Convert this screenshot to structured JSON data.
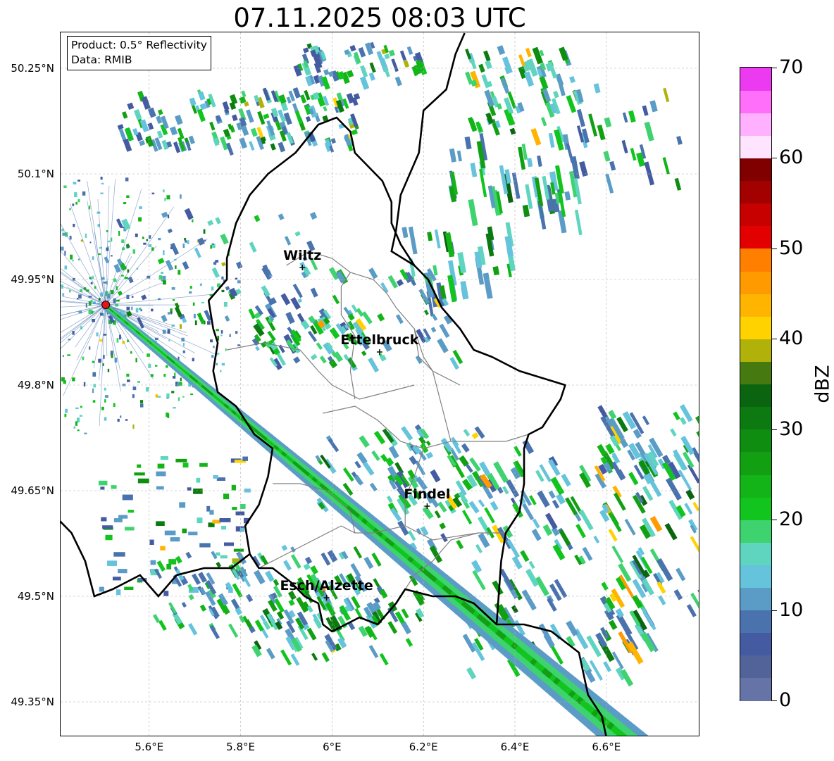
{
  "title": "07.11.2025 08:03 UTC",
  "info": {
    "product": "Product: 0.5° Reflectivity",
    "data": "Data: RMIB"
  },
  "map": {
    "lon_range": [
      5.4,
      6.8
    ],
    "lat_range": [
      49.3,
      50.3
    ],
    "lat_ticks": [
      {
        "value": 50.25,
        "label": "50.25°N"
      },
      {
        "value": 50.1,
        "label": "50.1°N"
      },
      {
        "value": 49.95,
        "label": "49.95°N"
      },
      {
        "value": 49.8,
        "label": "49.8°N"
      },
      {
        "value": 49.65,
        "label": "49.65°N"
      },
      {
        "value": 49.5,
        "label": "49.5°N"
      },
      {
        "value": 49.35,
        "label": "49.35°N"
      }
    ],
    "lon_ticks": [
      {
        "value": 5.6,
        "label": "5.6°E"
      },
      {
        "value": 5.8,
        "label": "5.8°E"
      },
      {
        "value": 6.0,
        "label": "6°E"
      },
      {
        "value": 6.2,
        "label": "6.2°E"
      },
      {
        "value": 6.4,
        "label": "6.4°E"
      },
      {
        "value": 6.6,
        "label": "6.6°E"
      }
    ],
    "grid": true,
    "radar_site": {
      "lon": 5.505,
      "lat": 49.914,
      "color": "#e8141b"
    },
    "cities": [
      {
        "name": "Wiltz",
        "lon": 5.935,
        "lat": 49.967
      },
      {
        "name": "Ettelbruck",
        "lon": 6.104,
        "lat": 49.847
      },
      {
        "name": "Findel",
        "lon": 6.208,
        "lat": 49.628
      },
      {
        "name": "Esch/Alzette",
        "lon": 5.988,
        "lat": 49.498
      }
    ],
    "luxembourg_border": [
      [
        5.92,
        50.13
      ],
      [
        5.97,
        50.17
      ],
      [
        6.01,
        50.18
      ],
      [
        6.04,
        50.16
      ],
      [
        6.05,
        50.13
      ],
      [
        6.08,
        50.11
      ],
      [
        6.11,
        50.09
      ],
      [
        6.13,
        50.06
      ],
      [
        6.13,
        50.03
      ],
      [
        6.15,
        50.0
      ],
      [
        6.18,
        49.97
      ],
      [
        6.21,
        49.95
      ],
      [
        6.24,
        49.91
      ],
      [
        6.28,
        49.88
      ],
      [
        6.31,
        49.85
      ],
      [
        6.35,
        49.84
      ],
      [
        6.41,
        49.82
      ],
      [
        6.46,
        49.81
      ],
      [
        6.51,
        49.8
      ],
      [
        6.5,
        49.78
      ],
      [
        6.48,
        49.76
      ],
      [
        6.46,
        49.74
      ],
      [
        6.43,
        49.73
      ],
      [
        6.42,
        49.71
      ],
      [
        6.42,
        49.66
      ],
      [
        6.41,
        49.62
      ],
      [
        6.38,
        49.59
      ],
      [
        6.37,
        49.55
      ],
      [
        6.36,
        49.46
      ],
      [
        6.31,
        49.49
      ],
      [
        6.27,
        49.5
      ],
      [
        6.22,
        49.5
      ],
      [
        6.16,
        49.51
      ],
      [
        6.14,
        49.49
      ],
      [
        6.1,
        49.46
      ],
      [
        6.06,
        49.47
      ],
      [
        6.0,
        49.45
      ],
      [
        5.98,
        49.46
      ],
      [
        5.97,
        49.49
      ],
      [
        5.94,
        49.5
      ],
      [
        5.91,
        49.52
      ],
      [
        5.87,
        49.54
      ],
      [
        5.84,
        49.54
      ],
      [
        5.82,
        49.56
      ],
      [
        5.81,
        49.6
      ],
      [
        5.84,
        49.63
      ],
      [
        5.86,
        49.67
      ],
      [
        5.87,
        49.71
      ],
      [
        5.83,
        49.73
      ],
      [
        5.79,
        49.77
      ],
      [
        5.75,
        49.79
      ],
      [
        5.74,
        49.82
      ],
      [
        5.75,
        49.86
      ],
      [
        5.74,
        49.88
      ],
      [
        5.73,
        49.92
      ],
      [
        5.77,
        49.95
      ],
      [
        5.77,
        49.98
      ],
      [
        5.79,
        50.03
      ],
      [
        5.82,
        50.07
      ],
      [
        5.86,
        50.1
      ],
      [
        5.92,
        50.13
      ]
    ],
    "germany_belgium_border": [
      [
        6.29,
        50.3
      ],
      [
        6.27,
        50.27
      ],
      [
        6.25,
        50.22
      ],
      [
        6.2,
        50.19
      ],
      [
        6.19,
        50.13
      ],
      [
        6.15,
        50.07
      ],
      [
        6.14,
        50.02
      ],
      [
        6.13,
        49.99
      ],
      [
        6.18,
        49.97
      ]
    ],
    "france_border": [
      [
        5.4,
        49.61
      ],
      [
        5.43,
        49.59
      ],
      [
        5.46,
        49.55
      ],
      [
        5.48,
        49.5
      ],
      [
        5.52,
        49.51
      ],
      [
        5.58,
        49.53
      ],
      [
        5.62,
        49.5
      ],
      [
        5.66,
        49.53
      ],
      [
        5.72,
        49.54
      ],
      [
        5.78,
        49.54
      ],
      [
        5.82,
        49.56
      ]
    ],
    "france_germany_border": [
      [
        6.36,
        49.46
      ],
      [
        6.42,
        49.46
      ],
      [
        6.48,
        49.45
      ],
      [
        6.54,
        49.42
      ],
      [
        6.56,
        49.36
      ],
      [
        6.59,
        49.33
      ],
      [
        6.6,
        49.3
      ]
    ],
    "cantons": [
      [
        [
          5.9,
          49.97
        ],
        [
          5.95,
          49.99
        ],
        [
          6.0,
          49.98
        ],
        [
          6.04,
          49.96
        ],
        [
          6.09,
          49.95
        ],
        [
          6.12,
          49.93
        ],
        [
          6.14,
          49.91
        ],
        [
          6.18,
          49.88
        ],
        [
          6.19,
          49.84
        ],
        [
          6.22,
          49.82
        ],
        [
          6.28,
          49.8
        ]
      ],
      [
        [
          5.77,
          49.85
        ],
        [
          5.85,
          49.86
        ],
        [
          5.93,
          49.85
        ],
        [
          5.97,
          49.82
        ],
        [
          6.0,
          49.8
        ],
        [
          6.06,
          49.78
        ],
        [
          6.12,
          49.79
        ],
        [
          6.18,
          49.8
        ]
      ],
      [
        [
          5.98,
          49.76
        ],
        [
          6.05,
          49.77
        ],
        [
          6.1,
          49.75
        ],
        [
          6.15,
          49.72
        ],
        [
          6.2,
          49.71
        ],
        [
          6.26,
          49.72
        ],
        [
          6.31,
          49.72
        ],
        [
          6.38,
          49.72
        ],
        [
          6.43,
          49.73
        ]
      ],
      [
        [
          5.87,
          49.66
        ],
        [
          5.93,
          49.66
        ],
        [
          5.99,
          49.65
        ],
        [
          6.04,
          49.62
        ],
        [
          6.05,
          49.59
        ],
        [
          6.09,
          49.59
        ],
        [
          6.16,
          49.6
        ],
        [
          6.22,
          49.58
        ],
        [
          6.32,
          49.59
        ],
        [
          6.38,
          49.59
        ]
      ],
      [
        [
          5.84,
          49.54
        ],
        [
          5.9,
          49.56
        ],
        [
          5.96,
          49.58
        ],
        [
          6.02,
          49.6
        ],
        [
          6.05,
          49.59
        ]
      ],
      [
        [
          6.14,
          49.49
        ],
        [
          6.18,
          49.53
        ],
        [
          6.22,
          49.55
        ],
        [
          6.26,
          49.58
        ],
        [
          6.32,
          49.59
        ]
      ],
      [
        [
          6.05,
          49.78
        ],
        [
          6.04,
          49.82
        ],
        [
          6.05,
          49.87
        ],
        [
          6.02,
          49.9
        ],
        [
          6.02,
          49.94
        ],
        [
          6.04,
          49.96
        ]
      ],
      [
        [
          6.18,
          49.88
        ],
        [
          6.2,
          49.84
        ],
        [
          6.22,
          49.82
        ],
        [
          6.24,
          49.77
        ],
        [
          6.26,
          49.72
        ]
      ],
      [
        [
          6.16,
          49.6
        ],
        [
          6.16,
          49.64
        ],
        [
          6.18,
          49.67
        ],
        [
          6.2,
          49.71
        ]
      ]
    ]
  },
  "colorbar": {
    "label": "dBZ",
    "min": 0,
    "max": 70,
    "step": 2.5,
    "ticks": [
      0,
      10,
      20,
      30,
      40,
      50,
      60,
      70
    ],
    "colors": [
      "#6573a6",
      "#52639a",
      "#445ba1",
      "#4a72ad",
      "#5b9cc6",
      "#66c3dc",
      "#5fd5c0",
      "#3ed36f",
      "#12c51e",
      "#13b417",
      "#12a012",
      "#0e8d10",
      "#0c7a10",
      "#0b6510",
      "#467a10",
      "#b0b20a",
      "#ffd200",
      "#ffb400",
      "#ff9b00",
      "#ff7f00",
      "#e30000",
      "#c70000",
      "#a30000",
      "#800000",
      "#ffe4ff",
      "#ffb0ff",
      "#ff6ff9",
      "#eb3aef"
    ]
  }
}
